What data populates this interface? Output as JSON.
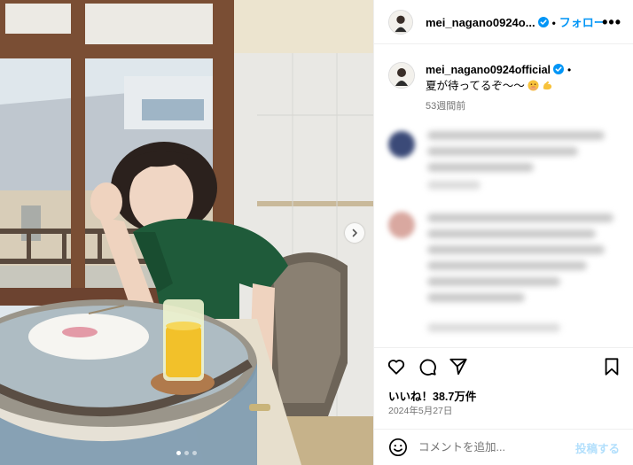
{
  "post": {
    "username": "mei_nagano0924official",
    "header_username": "mei_nagano0924o...",
    "separator": "•",
    "follow_label": "フォロー",
    "more_label": "•••",
    "caption": "夏が待ってるぞ〜〜",
    "caption_emojis": [
      "smiling-face-emoji",
      "flexed-biceps-emoji"
    ],
    "caption_time": "53週間前",
    "likes_text": "いいね！38.7万件",
    "date_text": "2024年5月27日",
    "comment_placeholder": "コメントを追加...",
    "post_button_label": "投稿する"
  },
  "carousel": {
    "slide_count": 3,
    "active_index": 0
  },
  "colors": {
    "accent": "#0095f6",
    "verified": "#0095f6",
    "post_button_disabled": "#b2dffc",
    "muted_text": "#737373"
  },
  "icons": [
    "verified-badge-icon",
    "more-options-icon",
    "heart-icon",
    "comment-icon",
    "share-icon",
    "bookmark-icon",
    "emoji-smile-icon",
    "chevron-right-icon"
  ]
}
